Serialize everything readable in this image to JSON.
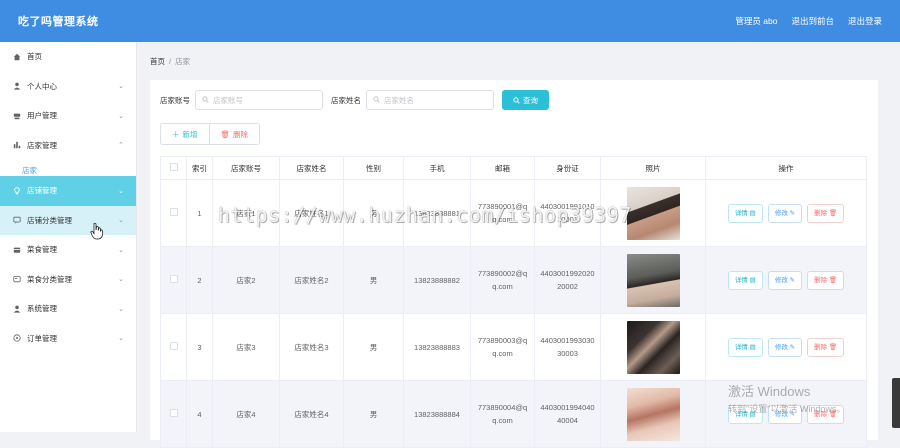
{
  "header": {
    "title": "吃了吗管理系统",
    "admin_label": "管理员 abo",
    "exit_front": "退出到前台",
    "logout": "退出登录"
  },
  "sidebar": {
    "items": [
      {
        "label": "首页",
        "icon": "home-icon"
      },
      {
        "label": "个人中心",
        "icon": "user-icon"
      },
      {
        "label": "用户管理",
        "icon": "users-icon"
      },
      {
        "label": "店家管理",
        "icon": "bar-chart-icon"
      },
      {
        "label": "店家",
        "icon": ""
      },
      {
        "label": "店铺管理",
        "icon": "location-icon"
      },
      {
        "label": "店铺分类管理",
        "icon": "chat-icon"
      },
      {
        "label": "菜食管理",
        "icon": "wallet-icon"
      },
      {
        "label": "菜食分类管理",
        "icon": "card-icon"
      },
      {
        "label": "系统管理",
        "icon": "user-icon"
      },
      {
        "label": "订单管理",
        "icon": "compass-icon"
      }
    ]
  },
  "breadcrumb": {
    "home": "首页",
    "separator": "/",
    "current": "店家"
  },
  "search": {
    "account_label": "店家账号",
    "account_placeholder": "店家账号",
    "name_label": "店家姓名",
    "name_placeholder": "店家姓名",
    "query_button": "查询"
  },
  "actions": {
    "add": "新增",
    "delete": "删除"
  },
  "table": {
    "headers": [
      "",
      "索引",
      "店家账号",
      "店家姓名",
      "性别",
      "手机",
      "邮箱",
      "身份证",
      "照片",
      "操作"
    ],
    "rows": [
      {
        "index": "1",
        "account": "店家1",
        "name": "店家姓名1",
        "gender": "男",
        "phone": "13823888881",
        "email": "773890001@qq.com",
        "id_card": "440300199101010001"
      },
      {
        "index": "2",
        "account": "店家2",
        "name": "店家姓名2",
        "gender": "男",
        "phone": "13823888882",
        "email": "773890002@qq.com",
        "id_card": "440300199202020002"
      },
      {
        "index": "3",
        "account": "店家3",
        "name": "店家姓名3",
        "gender": "男",
        "phone": "13823888883",
        "email": "773890003@qq.com",
        "id_card": "440300199303030003"
      },
      {
        "index": "4",
        "account": "店家4",
        "name": "店家姓名4",
        "gender": "男",
        "phone": "13823888884",
        "email": "773890004@qq.com",
        "id_card": "440300199404040004"
      }
    ],
    "op_detail": "详情",
    "op_edit": "修改",
    "op_delete": "删除"
  },
  "overlay": {
    "watermark": "https://www.huzhan.com/ishop39397",
    "win_title": "激活 Windows",
    "win_sub": "转到\"设置\"以激活 Windows。"
  },
  "colors": {
    "header_bg": "#3f8de3",
    "accent": "#2cc0d8",
    "active_menu": "#5fd0e6",
    "danger": "#f56c6c"
  }
}
